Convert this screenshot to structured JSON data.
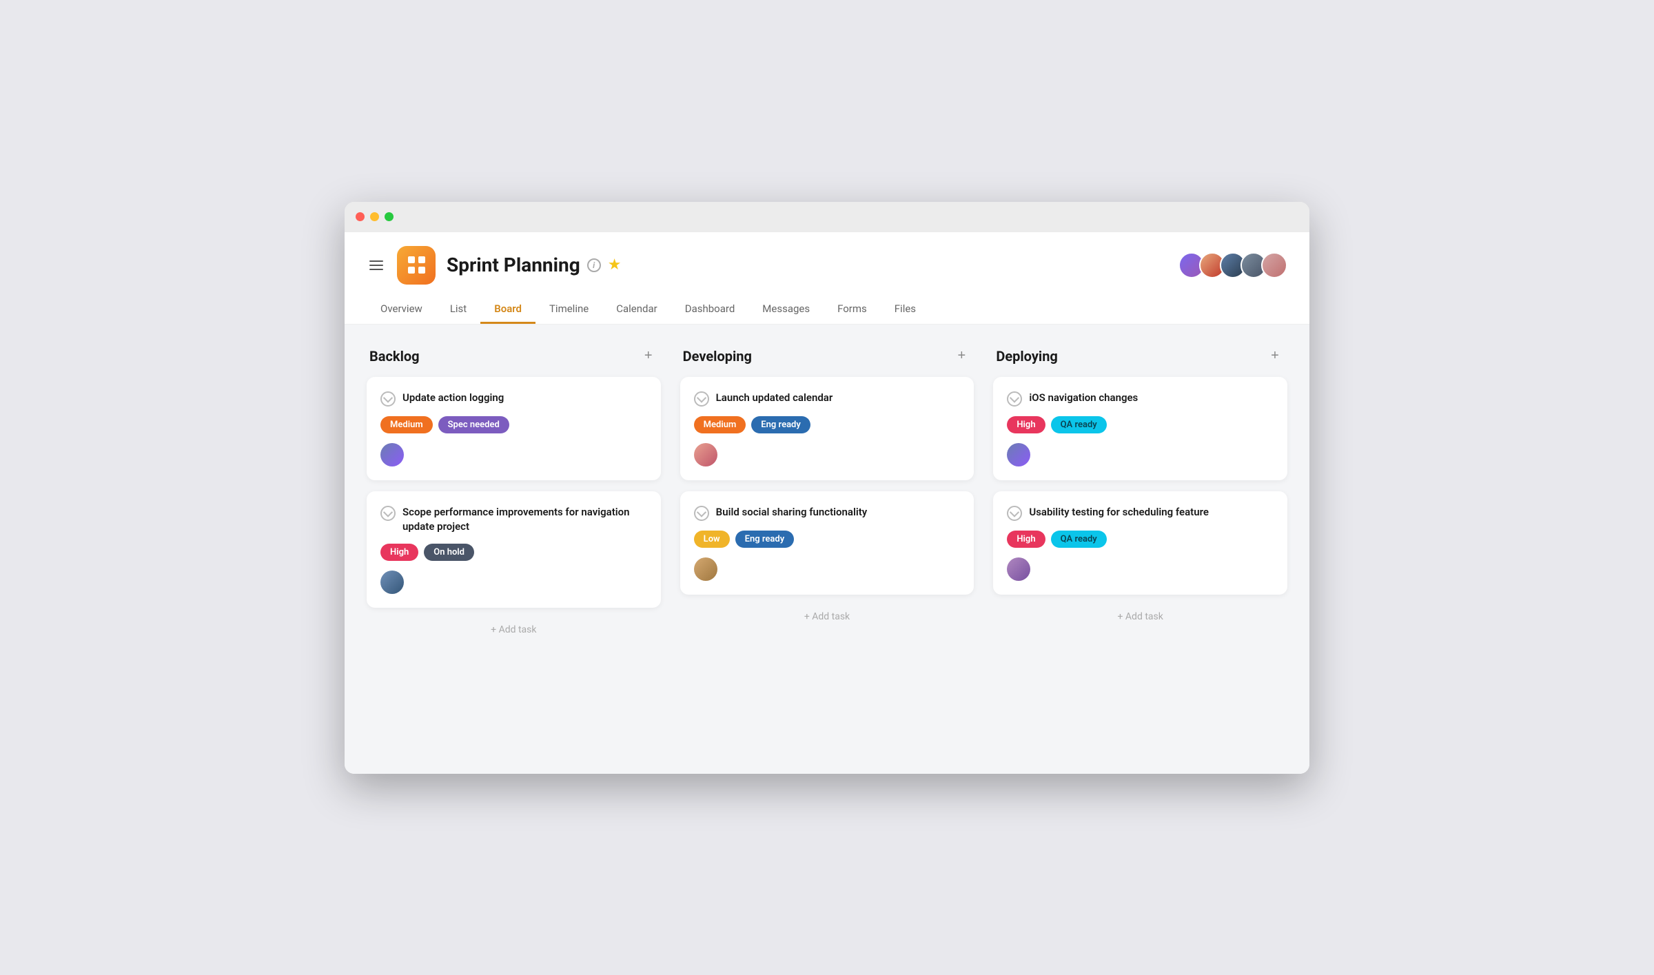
{
  "window": {
    "dots": [
      "red",
      "yellow",
      "green"
    ]
  },
  "header": {
    "menu_label": "menu",
    "logo_alt": "app logo",
    "project_title": "Sprint Planning",
    "info_label": "i",
    "star_label": "★",
    "active_tab": "Board",
    "tabs": [
      "Overview",
      "List",
      "Board",
      "Timeline",
      "Calendar",
      "Dashboard",
      "Messages",
      "Forms",
      "Files"
    ]
  },
  "avatars": [
    {
      "id": "av1",
      "label": "User 1"
    },
    {
      "id": "av2",
      "label": "User 2"
    },
    {
      "id": "av3",
      "label": "User 3"
    },
    {
      "id": "av4",
      "label": "User 4"
    },
    {
      "id": "av5",
      "label": "User 5"
    }
  ],
  "columns": [
    {
      "id": "backlog",
      "title": "Backlog",
      "add_label": "+",
      "cards": [
        {
          "id": "card-1",
          "title": "Update action logging",
          "tags": [
            {
              "label": "Medium",
              "type": "medium"
            },
            {
              "label": "Spec needed",
              "type": "spec-needed"
            }
          ],
          "avatar": {
            "id": "face1"
          }
        },
        {
          "id": "card-2",
          "title": "Scope performance improvements for navigation update project",
          "tags": [
            {
              "label": "High",
              "type": "high"
            },
            {
              "label": "On hold",
              "type": "on-hold"
            }
          ],
          "avatar": {
            "id": "face3"
          }
        }
      ],
      "add_task_label": "+ Add task"
    },
    {
      "id": "developing",
      "title": "Developing",
      "add_label": "+",
      "cards": [
        {
          "id": "card-3",
          "title": "Launch updated calendar",
          "tags": [
            {
              "label": "Medium",
              "type": "medium"
            },
            {
              "label": "Eng ready",
              "type": "eng-ready"
            }
          ],
          "avatar": {
            "id": "face2"
          }
        },
        {
          "id": "card-4",
          "title": "Build social sharing functionality",
          "tags": [
            {
              "label": "Low",
              "type": "low"
            },
            {
              "label": "Eng ready",
              "type": "eng-ready"
            }
          ],
          "avatar": {
            "id": "face4"
          }
        }
      ],
      "add_task_label": "+ Add task"
    },
    {
      "id": "deploying",
      "title": "Deploying",
      "add_label": "+",
      "cards": [
        {
          "id": "card-5",
          "title": "iOS navigation changes",
          "tags": [
            {
              "label": "High",
              "type": "high"
            },
            {
              "label": "QA ready",
              "type": "qa-ready"
            }
          ],
          "avatar": {
            "id": "face1"
          }
        },
        {
          "id": "card-6",
          "title": "Usability testing for scheduling feature",
          "tags": [
            {
              "label": "High",
              "type": "high"
            },
            {
              "label": "QA ready",
              "type": "qa-ready"
            }
          ],
          "avatar": {
            "id": "face5"
          }
        }
      ],
      "add_task_label": "+ Add task"
    }
  ]
}
